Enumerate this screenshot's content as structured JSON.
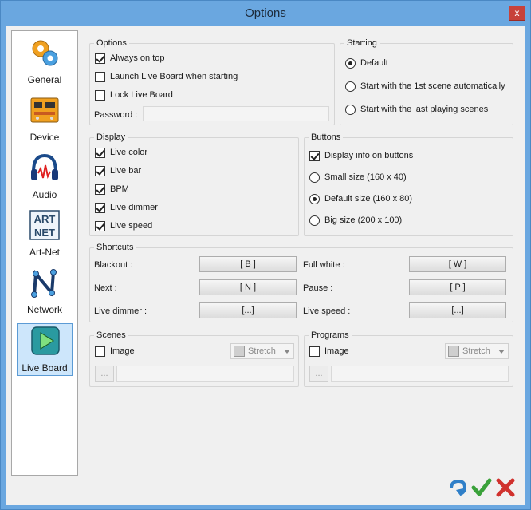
{
  "window": {
    "title": "Options",
    "close_label": "x"
  },
  "sidebar": {
    "items": [
      {
        "label": "General"
      },
      {
        "label": "Device"
      },
      {
        "label": "Audio"
      },
      {
        "label": "Art-Net"
      },
      {
        "label": "Network"
      },
      {
        "label": "Live Board"
      }
    ],
    "artnet_logo": [
      "ART",
      "NET"
    ]
  },
  "options": {
    "title": "Options",
    "always_on_top": "Always on top",
    "launch_live_board": "Launch Live Board when starting",
    "lock_live_board": "Lock Live Board",
    "password_label": "Password :",
    "password_value": ""
  },
  "starting": {
    "title": "Starting",
    "default": "Default",
    "first_scene": "Start with the 1st scene automatically",
    "last_scenes": "Start with the last playing scenes"
  },
  "display": {
    "title": "Display",
    "live_color": "Live color",
    "live_bar": "Live bar",
    "bpm": "BPM",
    "live_dimmer": "Live dimmer",
    "live_speed": "Live speed"
  },
  "buttons": {
    "title": "Buttons",
    "display_info": "Display info on buttons",
    "small_size": "Small size (160 x 40)",
    "default_size": "Default size (160 x 80)",
    "big_size": "Big size (200 x 100)"
  },
  "shortcuts": {
    "title": "Shortcuts",
    "blackout_label": "Blackout :",
    "blackout_key": "[ B ]",
    "full_white_label": "Full white :",
    "full_white_key": "[ W ]",
    "next_label": "Next :",
    "next_key": "[ N ]",
    "pause_label": "Pause :",
    "pause_key": "[ P ]",
    "live_dimmer_label": "Live dimmer :",
    "live_dimmer_key": "[...]",
    "live_speed_label": "Live speed :",
    "live_speed_key": "[...]"
  },
  "scenes": {
    "title": "Scenes",
    "image_label": "Image",
    "stretch": "Stretch",
    "browse": "...",
    "path": ""
  },
  "programs": {
    "title": "Programs",
    "image_label": "Image",
    "stretch": "Stretch",
    "browse": "...",
    "path": ""
  },
  "colors": {
    "accent": "#5b9bd5",
    "titlebar": "#6aa7e0",
    "ok_green": "#3aa13a",
    "cancel_red": "#d0312d",
    "undo_blue": "#2f7fc8"
  }
}
